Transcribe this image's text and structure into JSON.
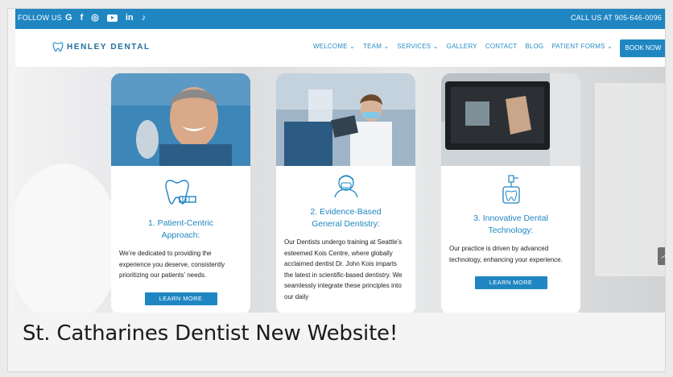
{
  "topbar": {
    "follow_label": "FOLLOW US",
    "socials": [
      {
        "icon": "google-icon",
        "glyph": "G"
      },
      {
        "icon": "facebook-icon",
        "glyph": "f"
      },
      {
        "icon": "instagram-icon",
        "glyph": "◎"
      },
      {
        "icon": "youtube-icon",
        "glyph": ""
      },
      {
        "icon": "linkedin-icon",
        "glyph": "in"
      },
      {
        "icon": "tiktok-icon",
        "glyph": "♪"
      }
    ],
    "call_text": "CALL US AT 905-646-0096"
  },
  "nav": {
    "logo_text": "HENLEY DENTAL",
    "items": [
      "WELCOME ⌄",
      "TEAM ⌄",
      "SERVICES ⌄",
      "GALLERY",
      "CONTACT",
      "BLOG",
      "PATIENT FORMS ⌄"
    ],
    "book_now": "BOOK NOW"
  },
  "cards": [
    {
      "title_line1": "1. Patient-Centric",
      "title_line2": "Approach:",
      "text": "We’re dedicated to providing the experience you deserve, consistently prioritizing our patients’ needs.",
      "button": "LEARN MORE"
    },
    {
      "title_line1": "2. Evidence-Based",
      "title_line2": "General Dentistry:",
      "text": "Our Dentists undergo training at Seattle’s esteemed Kois Centre, where globally acclaimed dentist Dr. John Kois imparts the latest in scientific-based dentistry. We seamlessly integrate these principles into our daily"
    },
    {
      "title_line1": "3. Innovative Dental",
      "title_line2": "Technology:",
      "text": "Our practice is driven by advanced technology, enhancing your experience.",
      "button": "LEARN MORE"
    }
  ],
  "caption": "St. Catharines Dentist New Website!",
  "colors": {
    "brand_blue": "#1f86c2",
    "text_dark": "#222222"
  }
}
